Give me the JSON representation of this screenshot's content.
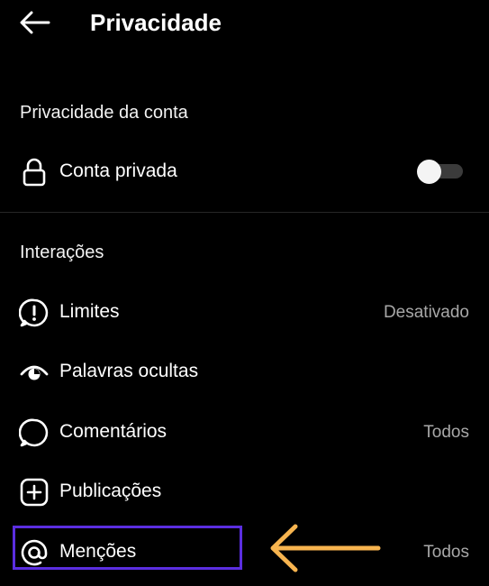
{
  "header": {
    "title": "Privacidade"
  },
  "account_section": {
    "title": "Privacidade da conta",
    "private_account": {
      "label": "Conta privada",
      "enabled": false
    }
  },
  "interactions_section": {
    "title": "Interações",
    "items": [
      {
        "label": "Limites",
        "value": "Desativado",
        "icon": "limits-icon"
      },
      {
        "label": "Palavras ocultas",
        "value": "",
        "icon": "hidden-words-icon"
      },
      {
        "label": "Comentários",
        "value": "Todos",
        "icon": "comment-icon"
      },
      {
        "label": "Publicações",
        "value": "",
        "icon": "add-post-icon"
      },
      {
        "label": "Menções",
        "value": "Todos",
        "icon": "mention-icon"
      }
    ]
  },
  "colors": {
    "background": "#000000",
    "text": "#ffffff",
    "secondary_text": "#a8a8a8",
    "highlight_border": "#5b2ee0",
    "arrow": "#f7b44f"
  }
}
